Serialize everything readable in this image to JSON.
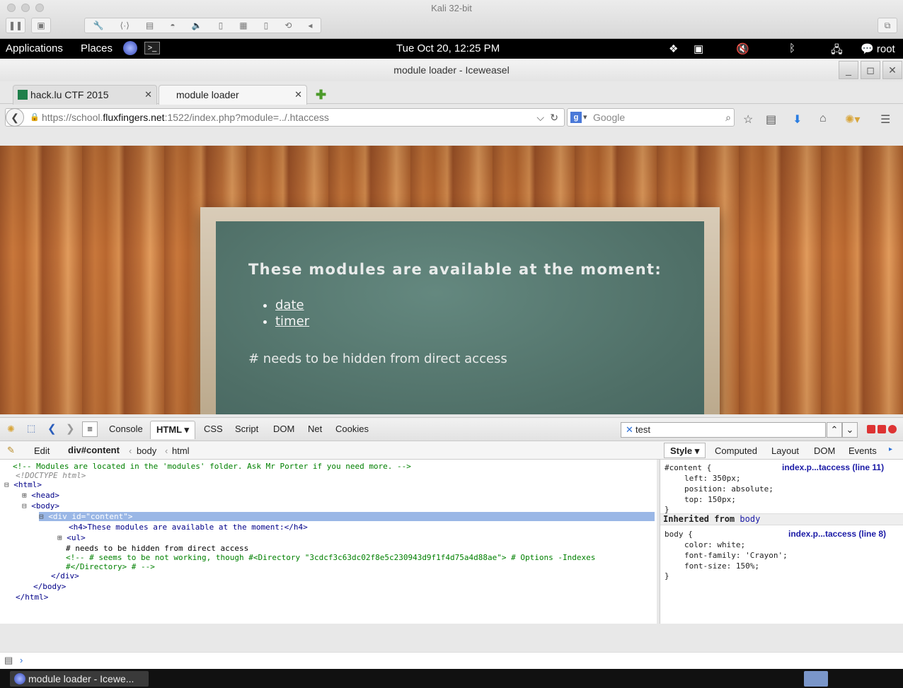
{
  "vm": {
    "title": "Kali 32-bit"
  },
  "gnome": {
    "applications": "Applications",
    "places": "Places",
    "clock": "Tue Oct 20, 12:25 PM",
    "user": "root"
  },
  "browser": {
    "window_title": "module loader - Iceweasel",
    "tabs": [
      {
        "label": "hack.lu CTF 2015"
      },
      {
        "label": "module loader"
      }
    ],
    "url": {
      "prefix": "https://school.",
      "host": "fluxfingers.net",
      "rest": ":1522/index.php?module=../.htaccess"
    },
    "search_placeholder": "Google"
  },
  "page": {
    "heading": "These modules are available at the moment:",
    "modules": [
      "date",
      "timer"
    ],
    "note": "# needs to be hidden from direct access"
  },
  "firebug": {
    "tabs": [
      "Console",
      "HTML",
      "CSS",
      "Script",
      "DOM",
      "Net",
      "Cookies"
    ],
    "search_value": "test",
    "edit": "Edit",
    "breadcrumb": [
      "div#content",
      "body",
      "html"
    ],
    "side_tabs": [
      "Style",
      "Computed",
      "Layout",
      "DOM",
      "Events"
    ],
    "html_lines": [
      "<!-- Modules are located in the 'modules' folder. Ask Mr Porter if you need more. -->",
      "<!DOCTYPE html>",
      "<html>",
      "<head>",
      "<body>",
      "<div id=\"content\">",
      "<h4>These modules are available at the moment:</h4>",
      "<ul>",
      "# needs to be hidden from direct access",
      "<!-- # seems to be not working, though #<Directory \"3cdcf3c63dc02f8e5c230943d9f1f4d75a4d88ae\"> # Options -Indexes",
      "#</Directory> # -->",
      "</div>",
      "</body>",
      "</html>"
    ],
    "style_rules": {
      "content_selector": "#content {",
      "content_source": "index.p...taccess (line 11)",
      "content_props": [
        "left: 350px;",
        "position: absolute;",
        "top: 150px;"
      ],
      "inherited_label": "Inherited from",
      "inherited_from": "body",
      "body_selector": "body {",
      "body_source": "index.p...taccess (line 8)",
      "body_props": [
        "color: white;",
        "font-family: 'Crayon';",
        "font-size: 150%;"
      ],
      "close": "}"
    }
  },
  "taskbar": {
    "window_label": "module loader - Icewe..."
  }
}
